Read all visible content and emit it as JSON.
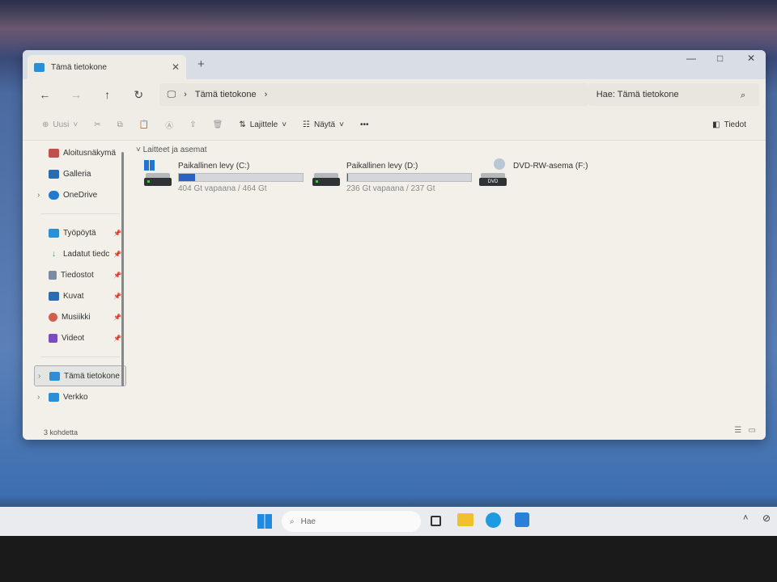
{
  "window": {
    "tab_title": "Tämä tietokone",
    "new_tab": "+",
    "close_tab": "✕",
    "minimize": "—",
    "maximize": "□",
    "close": "✕"
  },
  "address": {
    "breadcrumb": "Tämä tietokone",
    "search_placeholder": "Hae: Tämä tietokone"
  },
  "toolbar": {
    "new": "Uusi",
    "sort": "Lajittele",
    "view": "Näytä",
    "more": "•••",
    "details": "Tiedot"
  },
  "sidebar": {
    "items": [
      {
        "label": "Aloitusnäkymä",
        "icon": "home-icon",
        "color": "#c0504d"
      },
      {
        "label": "Galleria",
        "icon": "gallery-icon",
        "color": "#2b6cb0"
      },
      {
        "label": "OneDrive",
        "icon": "cloud-icon",
        "color": "#1e7bd0"
      }
    ],
    "pinned": [
      {
        "label": "Työpöytä",
        "icon": "desktop-icon",
        "color": "#2b8fd6"
      },
      {
        "label": "Ladatut tiedc",
        "icon": "download-icon",
        "color": "#2a9d5a"
      },
      {
        "label": "Tiedostot",
        "icon": "documents-icon",
        "color": "#7a8aa0"
      },
      {
        "label": "Kuvat",
        "icon": "pictures-icon",
        "color": "#2b6cb0"
      },
      {
        "label": "Musiikki",
        "icon": "music-icon",
        "color": "#d0604d"
      },
      {
        "label": "Videot",
        "icon": "videos-icon",
        "color": "#7b4cc0"
      }
    ],
    "bottom": [
      {
        "label": "Tämä tietokone",
        "icon": "computer-icon",
        "color": "#2b8fd6",
        "selected": true
      },
      {
        "label": "Verkko",
        "icon": "network-icon",
        "color": "#2b8fd6"
      }
    ]
  },
  "content": {
    "group": "Laitteet ja asemat",
    "drives": [
      {
        "name": "Paikallinen levy (C:)",
        "free": "404 Gt vapaana / 464 Gt",
        "used_fraction": 0.13
      },
      {
        "name": "Paikallinen levy (D:)",
        "free": "236 Gt vapaana / 237 Gt",
        "used_fraction": 0.004
      },
      {
        "name": "DVD-RW-asema (F:)",
        "badge": "DVD"
      }
    ]
  },
  "status": {
    "count": "3 kohdetta"
  },
  "taskbar": {
    "search": "Hae"
  },
  "colors": {
    "accent": "#2a62c4"
  }
}
